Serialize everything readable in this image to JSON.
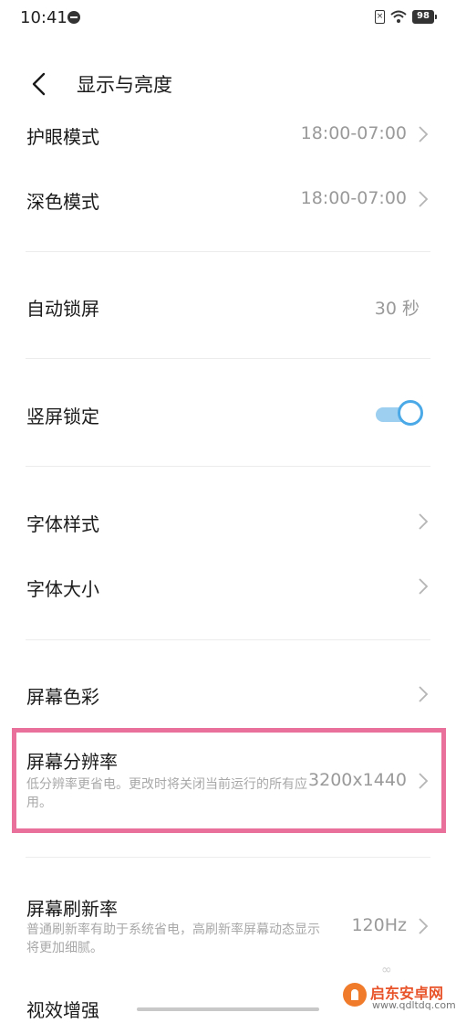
{
  "status_bar": {
    "time": "10:41",
    "battery": "98",
    "icons": [
      "do-not-disturb-icon",
      "sim-icon",
      "wifi-icon",
      "battery-icon"
    ]
  },
  "header": {
    "title": "显示与亮度",
    "back_icon": "chevron-left-icon"
  },
  "rows": {
    "eye_protection": {
      "label": "护眼模式",
      "value": "18:00-07:00"
    },
    "dark_mode": {
      "label": "深色模式",
      "value": "18:00-07:00"
    },
    "auto_lock": {
      "label": "自动锁屏",
      "value": "30 秒"
    },
    "portrait_lock": {
      "label": "竖屏锁定",
      "toggle_on": true
    },
    "font_style": {
      "label": "字体样式"
    },
    "font_size": {
      "label": "字体大小"
    },
    "screen_color": {
      "label": "屏幕色彩"
    },
    "resolution": {
      "label": "屏幕分辨率",
      "description": "低分辨率更省电。更改时将关闭当前运行的所有应用。",
      "value": "3200x1440"
    },
    "refresh_rate": {
      "label": "屏幕刷新率",
      "description": "普通刷新率有助于系统省电，高刷新率屏幕动态显示将更加细腻。",
      "value": "120Hz"
    },
    "visual_enhance": {
      "label": "视效增强"
    }
  },
  "watermark": {
    "name": "启东安卓网",
    "url": "www.qdltdq.com"
  },
  "colors": {
    "highlight": "#e8709a",
    "toggle_accent": "#4aa9e6",
    "secondary_text": "#9a9a9a"
  }
}
